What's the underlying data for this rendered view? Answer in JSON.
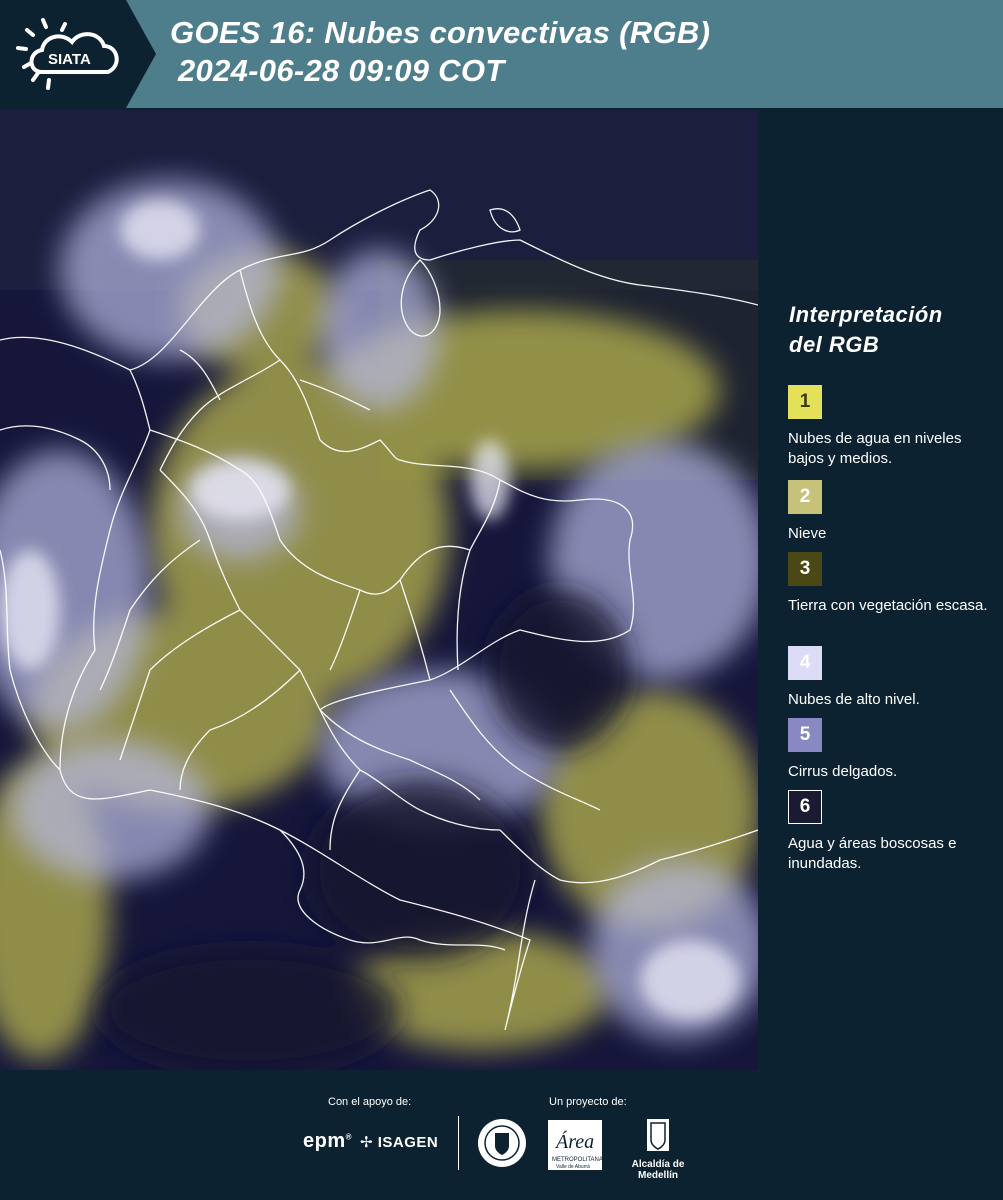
{
  "header": {
    "logo_text": "SIATA",
    "title_line1": "GOES 16: Nubes convectivas (RGB)",
    "title_line2": "2024-06-28 09:09 COT",
    "background_color": "#4e7e8c"
  },
  "map": {
    "description_icon": "satellite-rgb-map",
    "colors": {
      "background": "#16163a",
      "cloud_high": "#c9cbe6",
      "cloud_low": "#cfcf60",
      "borders": "#ffffff"
    }
  },
  "legend": {
    "title_line1": "Interpretación",
    "title_line2": "del RGB",
    "items": [
      {
        "number": "1",
        "label": "Nubes de agua en niveles bajos y medios.",
        "color": "#e4e05a",
        "text_color": "#3b3a10"
      },
      {
        "number": "2",
        "label": "Nieve",
        "color": "#c7c27a",
        "text_color": "#ffffff"
      },
      {
        "number": "3",
        "label": "Tierra con vegetación escasa.",
        "color": "#4a4814",
        "text_color": "#ffffff"
      },
      {
        "number": "4",
        "label": "Nubes de alto nivel.",
        "color": "#dcdcf6",
        "text_color": "#ffffff"
      },
      {
        "number": "5",
        "label": "Cirrus delgados.",
        "color": "#8888c2",
        "text_color": "#ffffff"
      },
      {
        "number": "6",
        "label": "Agua y áreas boscosas e inundadas.",
        "color": "#1a1a32",
        "text_color": "#ffffff"
      }
    ]
  },
  "footer": {
    "support_label": "Con el apoyo de:",
    "project_label": "Un proyecto de:",
    "epm_logo": "epm",
    "isagen_logo": "ISAGEN",
    "alcaldia_logo": "Alcaldía de Medellín",
    "area_logo": "Área Metropolitana Valle de Aburrá"
  }
}
